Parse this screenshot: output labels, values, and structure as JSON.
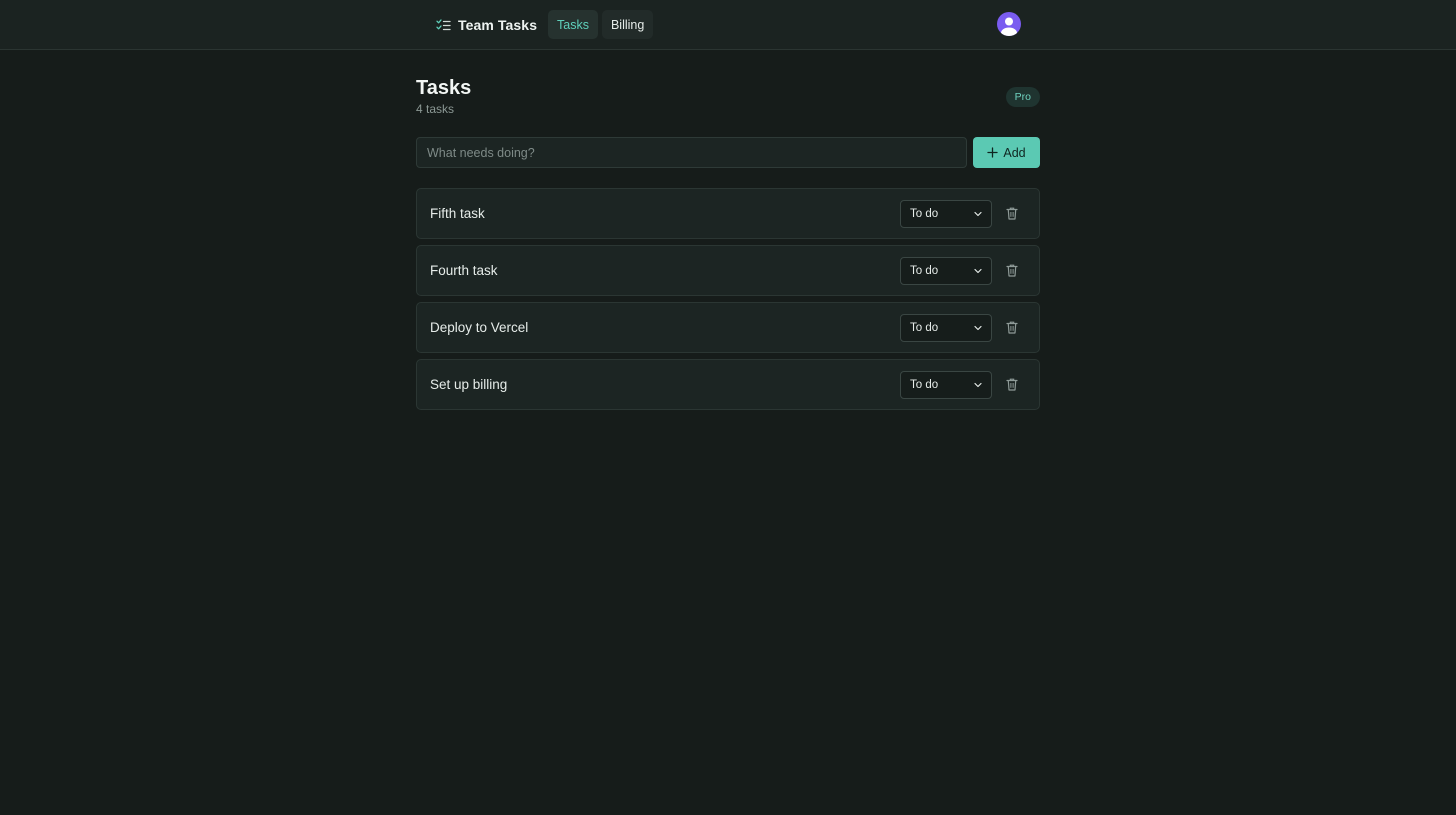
{
  "header": {
    "brand": "Team Tasks",
    "brand_icon": "checklist-icon",
    "nav": [
      {
        "label": "Tasks",
        "active": true
      },
      {
        "label": "Billing",
        "active": false
      }
    ],
    "avatar_icon": "user-avatar-icon"
  },
  "page": {
    "title": "Tasks",
    "count": "4 tasks",
    "plan_badge": "Pro"
  },
  "add_task": {
    "placeholder": "What needs doing?",
    "value": "",
    "button_label": "Add",
    "button_icon": "plus-icon"
  },
  "tasks": [
    {
      "name": "Fifth task",
      "status": "To do"
    },
    {
      "name": "Fourth task",
      "status": "To do"
    },
    {
      "name": "Deploy to Vercel",
      "status": "To do"
    },
    {
      "name": "Set up billing",
      "status": "To do"
    }
  ],
  "colors": {
    "background": "#161c1a",
    "accent": "#5bc9b3",
    "avatar": "#7a5cf0"
  }
}
